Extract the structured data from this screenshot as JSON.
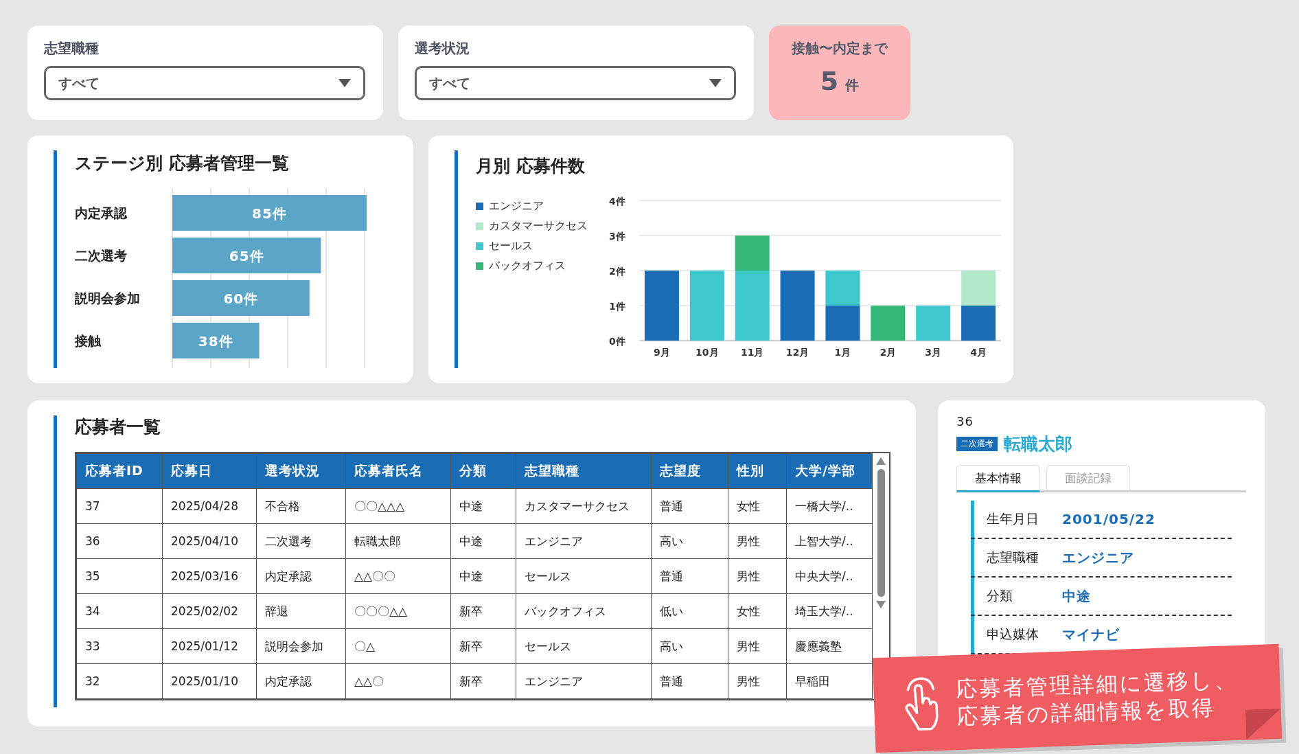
{
  "filters": [
    {
      "label": "志望職種",
      "value": "すべて"
    },
    {
      "label": "選考状況",
      "value": "すべて"
    }
  ],
  "summary": {
    "label": "接触〜内定まで",
    "count": "5",
    "unit": "件"
  },
  "stage_chart": {
    "title": "ステージ別 応募者管理一覧",
    "chart_data": {
      "type": "bar",
      "orientation": "horizontal",
      "categories": [
        "内定承認",
        "二次選考",
        "説明会参加",
        "接触"
      ],
      "values": [
        85,
        65,
        60,
        38
      ],
      "value_labels": [
        "85件",
        "65件",
        "60件",
        "38件"
      ]
    }
  },
  "monthly_chart": {
    "title": "月別 応募件数",
    "chart_data": {
      "type": "bar",
      "stacked": true,
      "categories": [
        "9月",
        "10月",
        "11月",
        "12月",
        "1月",
        "2月",
        "3月",
        "4月"
      ],
      "ylim": [
        0,
        4
      ],
      "yticks": [
        {
          "value": 0,
          "label": "0件"
        },
        {
          "value": 1,
          "label": "1件"
        },
        {
          "value": 2,
          "label": "2件"
        },
        {
          "value": 3,
          "label": "3件"
        },
        {
          "value": 4,
          "label": "4件"
        }
      ],
      "series": [
        {
          "name": "エンジニア",
          "color": "#1a6db5",
          "values": [
            2,
            0,
            0,
            2,
            1,
            0,
            0,
            1
          ]
        },
        {
          "name": "カスタマーサクセス",
          "color": "#b3e8cb",
          "values": [
            0,
            0,
            0,
            0,
            0,
            0,
            0,
            1
          ]
        },
        {
          "name": "セールス",
          "color": "#3ec7cc",
          "values": [
            0,
            2,
            2,
            0,
            1,
            0,
            1,
            0
          ]
        },
        {
          "name": "バックオフィス",
          "color": "#35b778",
          "values": [
            0,
            0,
            1,
            0,
            0,
            1,
            0,
            0
          ]
        }
      ],
      "grid": true
    }
  },
  "applicants": {
    "title": "応募者一覧",
    "columns": [
      "応募者ID",
      "応募日",
      "選考状況",
      "応募者氏名",
      "分類",
      "志望職種",
      "志望度",
      "性別",
      "大学/学部"
    ],
    "rows": [
      {
        "cells": [
          "37",
          "2025/04/28",
          "不合格",
          "〇〇△△△",
          "中途",
          "カスタマーサクセス",
          "普通",
          "女性",
          "一橋大学/.."
        ]
      },
      {
        "cells": [
          "36",
          "2025/04/10",
          "二次選考",
          "転職太郎",
          "中途",
          "エンジニア",
          "高い",
          "男性",
          "上智大学/.."
        ]
      },
      {
        "cells": [
          "35",
          "2025/03/16",
          "内定承認",
          "△△〇〇",
          "中途",
          "セールス",
          "普通",
          "男性",
          "中央大学/.."
        ]
      },
      {
        "cells": [
          "34",
          "2025/02/02",
          "辞退",
          "〇〇〇△△",
          "新卒",
          "バックオフィス",
          "低い",
          "女性",
          "埼玉大学/.."
        ]
      },
      {
        "cells": [
          "33",
          "2025/01/12",
          "説明会参加",
          "〇△",
          "新卒",
          "セールス",
          "高い",
          "男性",
          "慶應義塾"
        ]
      },
      {
        "cells": [
          "32",
          "2025/01/10",
          "内定承認",
          "△△〇",
          "新卒",
          "エンジニア",
          "普通",
          "男性",
          "早稲田"
        ]
      }
    ]
  },
  "detail": {
    "id": "36",
    "badge": "二次選考",
    "name": "転職太郎",
    "tabs": [
      {
        "label": "基本情報",
        "selected": true
      },
      {
        "label": "面談記録",
        "selected": false
      }
    ],
    "fields": [
      {
        "label": "生年月日",
        "value": "2001/05/22"
      },
      {
        "label": "志望職種",
        "value": "エンジニア"
      },
      {
        "label": "分類",
        "value": "中途"
      },
      {
        "label": "申込媒体",
        "value": "マイナビ"
      }
    ]
  },
  "callout": {
    "lines": [
      "応募者管理詳細に遷移し、",
      "応募者の詳細情報を取得"
    ]
  }
}
